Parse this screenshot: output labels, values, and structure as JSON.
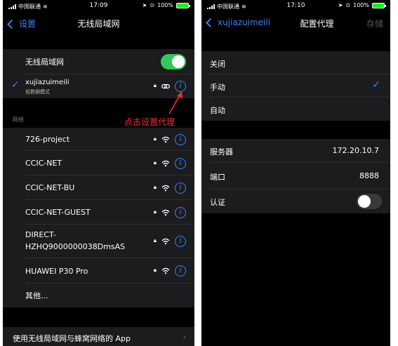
{
  "left": {
    "status": {
      "carrier": "中国联通",
      "time": "17:09",
      "battery": "100%"
    },
    "nav": {
      "back_label": "设置",
      "title": "无线局域网"
    },
    "wifi_toggle": {
      "label": "无线局域网",
      "on": true
    },
    "connected": {
      "name": "xujiazuimeili",
      "subtitle": "低数据模式"
    },
    "section_header": "网络",
    "annotation": "点击设置代理",
    "networks": [
      {
        "name": "726-project"
      },
      {
        "name": "CCIC-NET"
      },
      {
        "name": "CCIC-NET-BU"
      },
      {
        "name": "CCIC-NET-GUEST"
      },
      {
        "name_line1": "DIRECT-",
        "name_line2": "HZHQ9000000038DmsAS"
      },
      {
        "name": "HUAWEI P30 Pro"
      }
    ],
    "other": "其他...",
    "footer": "使用无线局域网与蜂窝网络的 App"
  },
  "right": {
    "status": {
      "carrier": "中国联通",
      "time": "17:10",
      "battery": "100%"
    },
    "nav": {
      "back_label": "xujiazuimeili",
      "title": "配置代理",
      "save_label": "存储"
    },
    "modes": [
      {
        "label": "关闭",
        "selected": false
      },
      {
        "label": "手动",
        "selected": true
      },
      {
        "label": "自动",
        "selected": false
      }
    ],
    "fields": {
      "server_label": "服务器",
      "server_value": "172.20.10.7",
      "port_label": "端口",
      "port_value": "8888",
      "auth_label": "认证",
      "auth_on": false
    }
  }
}
